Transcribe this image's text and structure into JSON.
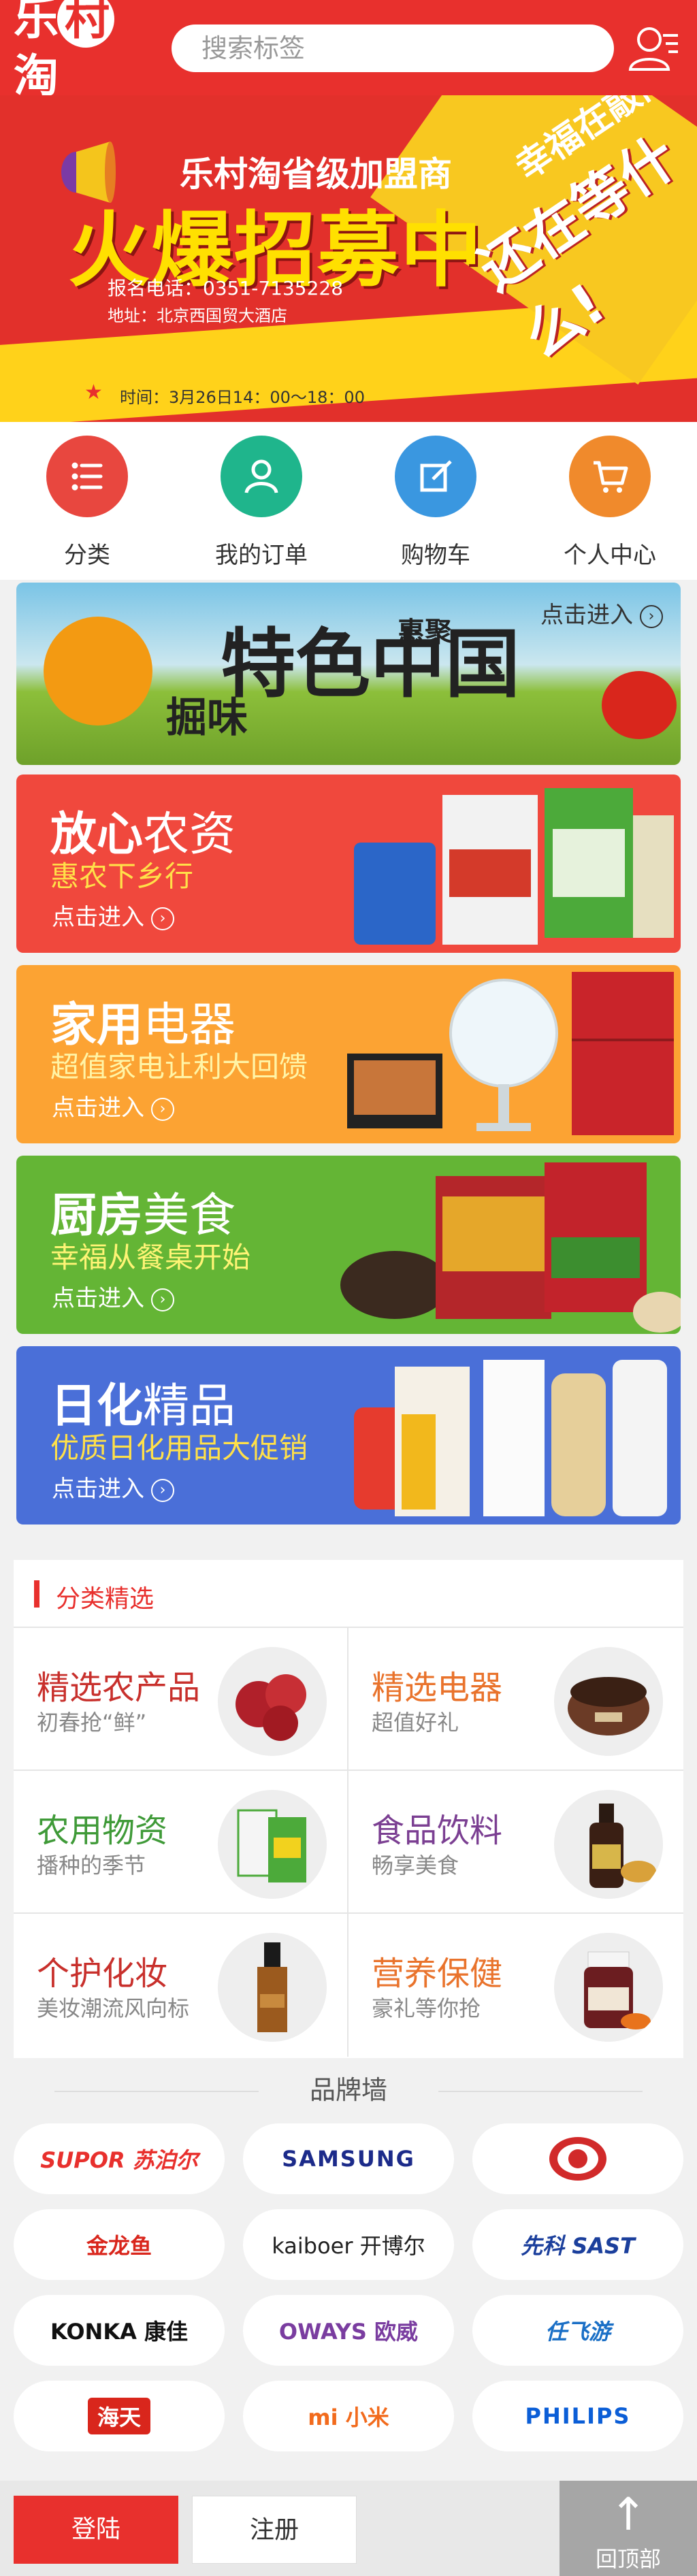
{
  "header": {
    "logo_text": [
      "乐",
      "村",
      "淘"
    ],
    "search_placeholder": "搜索标签"
  },
  "banner": {
    "title_small": "乐村淘省级加盟商",
    "title_big": "火爆招募中",
    "phone": "报名电话：0351-7135228",
    "address": "地址：北京西国贸大酒店",
    "slogan1": "幸福在敲门",
    "slogan2": "还在等什么!",
    "time": "时间：3月26日14：00～18：00"
  },
  "nav": [
    {
      "label": "分类",
      "color": "#e8473f"
    },
    {
      "label": "我的订单",
      "color": "#1fb58c"
    },
    {
      "label": "购物车",
      "color": "#3a97e0"
    },
    {
      "label": "个人中心",
      "color": "#f08a2c"
    }
  ],
  "promo": {
    "c1": {
      "title": "特色中国",
      "w1": "掘味",
      "w2": "惠聚",
      "enter": "点击进入"
    },
    "c2": {
      "t1": "放心",
      "t2": "农资",
      "sub": "惠农下乡行",
      "enter": "点击进入"
    },
    "c3": {
      "t1": "家用",
      "t2": "电器",
      "sub": "超值家电让利大回馈",
      "enter": "点击进入"
    },
    "c4": {
      "t1": "厨房",
      "t2": "美食",
      "sub": "幸福从餐桌开始",
      "enter": "点击进入"
    },
    "c5": {
      "t1": "日化",
      "t2": "精品",
      "sub": "优质日化用品大促销",
      "enter": "点击进入"
    }
  },
  "category": {
    "heading": "分类精选",
    "items": [
      {
        "title": "精选农产品",
        "sub": "初春抢“鲜”",
        "color": "#c8302c"
      },
      {
        "title": "精选电器",
        "sub": "超值好礼",
        "color": "#e9732c"
      },
      {
        "title": "农用物资",
        "sub": "播种的季节",
        "color": "#3f9a38"
      },
      {
        "title": "食品饮料",
        "sub": "畅享美食",
        "color": "#7b3f92"
      },
      {
        "title": "个护化妆",
        "sub": "美妆潮流风向标",
        "color": "#c8302c"
      },
      {
        "title": "营养保健",
        "sub": "豪礼等你抢",
        "color": "#e9732c"
      }
    ]
  },
  "brand_wall": {
    "title": "品牌墙",
    "brands": [
      {
        "name": "SUPOR 苏泊尔",
        "color": "#e8302d"
      },
      {
        "name": "SAMSUNG",
        "color": "#1c2b8a"
      },
      {
        "name": "",
        "color": "#d12a2a"
      },
      {
        "name": "金龙鱼",
        "color": "#d9261c"
      },
      {
        "name": "kaiboer 开博尔",
        "color": "#222222"
      },
      {
        "name": "先科 SAST",
        "color": "#1b3f9c"
      },
      {
        "name": "KONKA 康佳",
        "color": "#111111"
      },
      {
        "name": "OWAYS 欧威",
        "color": "#7a3da0"
      },
      {
        "name": "任飞游",
        "color": "#1a6fc6"
      },
      {
        "name": "海天",
        "color": "#d9261c"
      },
      {
        "name": "mi 小米",
        "color": "#f26b1d"
      },
      {
        "name": "PHILIPS",
        "color": "#0b5ed7"
      }
    ]
  },
  "footer": {
    "login": "登陆",
    "register": "注册",
    "back_top": "回顶部"
  }
}
